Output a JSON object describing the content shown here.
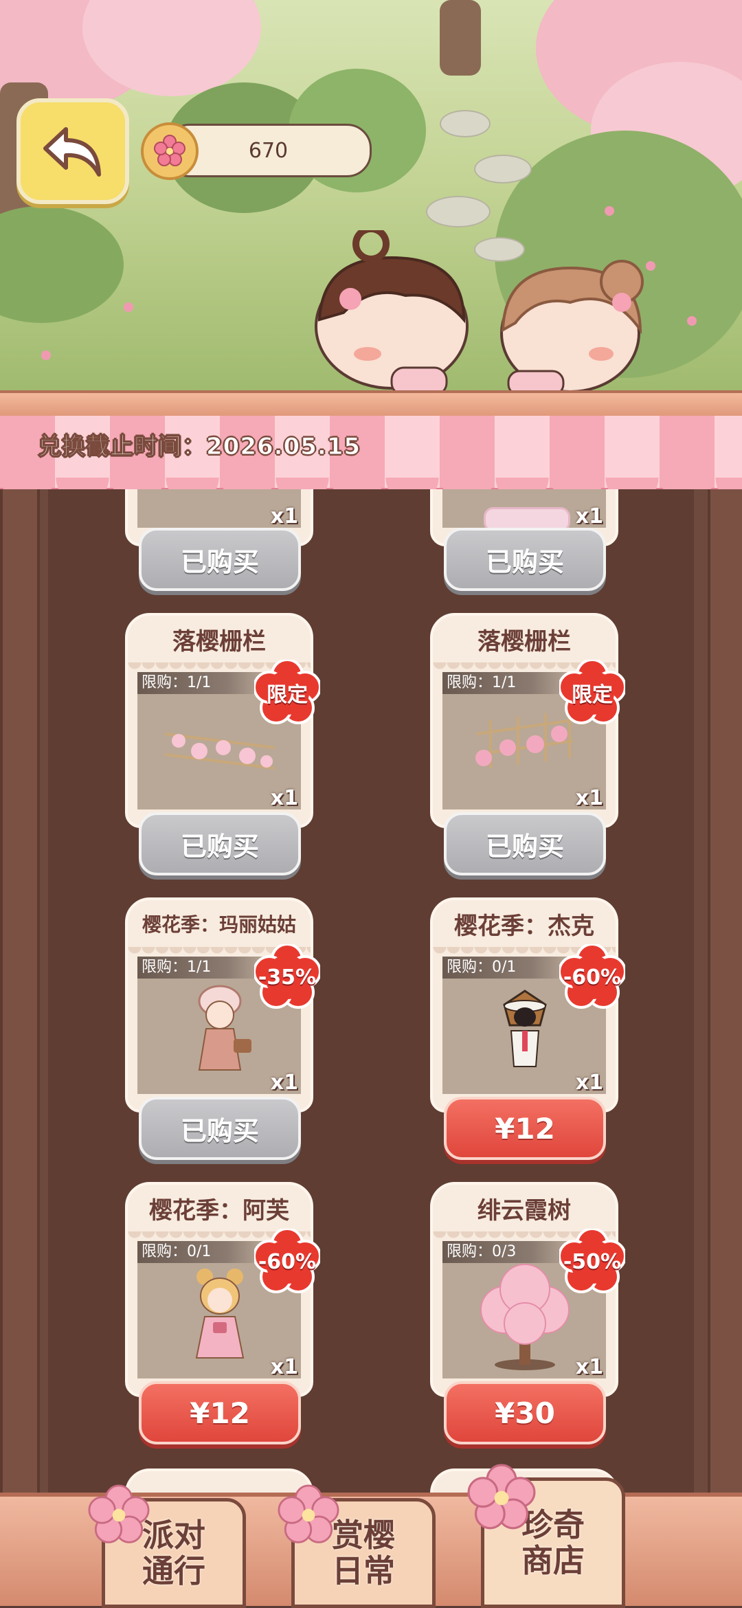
{
  "header": {
    "coin_amount": "670",
    "deadline_text": "兑换截止时间：2026.05.15"
  },
  "shop_items": [
    {
      "title": "",
      "qty": "x1",
      "button": "已购买",
      "state": "purchased"
    },
    {
      "title": "",
      "qty": "x1",
      "button": "已购买",
      "state": "purchased"
    },
    {
      "title": "落樱栅栏",
      "limit": "限购：1/1",
      "badge": "限定",
      "qty": "x1",
      "button": "已购买",
      "state": "purchased"
    },
    {
      "title": "落樱栅栏",
      "limit": "限购：1/1",
      "badge": "限定",
      "qty": "x1",
      "button": "已购买",
      "state": "purchased"
    },
    {
      "title": "樱花季：玛丽姑姑",
      "limit": "限购：1/1",
      "badge": "-35%",
      "qty": "x1",
      "button": "已购买",
      "state": "purchased"
    },
    {
      "title": "樱花季：杰克",
      "limit": "限购：0/1",
      "badge": "-60%",
      "qty": "x1",
      "button": "¥12",
      "state": "available"
    },
    {
      "title": "樱花季：阿芙",
      "limit": "限购：0/1",
      "badge": "-60%",
      "qty": "x1",
      "button": "¥12",
      "state": "available"
    },
    {
      "title": "绯云霞树",
      "limit": "限购：0/3",
      "badge": "-50%",
      "qty": "x1",
      "button": "¥30",
      "state": "available"
    }
  ],
  "bottom_nav": [
    {
      "line1": "派对",
      "line2": "通行"
    },
    {
      "line1": "赏樱",
      "line2": "日常"
    },
    {
      "line1": "珍奇",
      "line2": "商店",
      "active": true
    }
  ],
  "colors": {
    "accent_red": "#e0463c",
    "badge_red": "#e8392f",
    "purchased_grey": "#aeaeb2",
    "awning_pink": "#f6a9b6",
    "back_button_yellow": "#f7dd6a"
  }
}
